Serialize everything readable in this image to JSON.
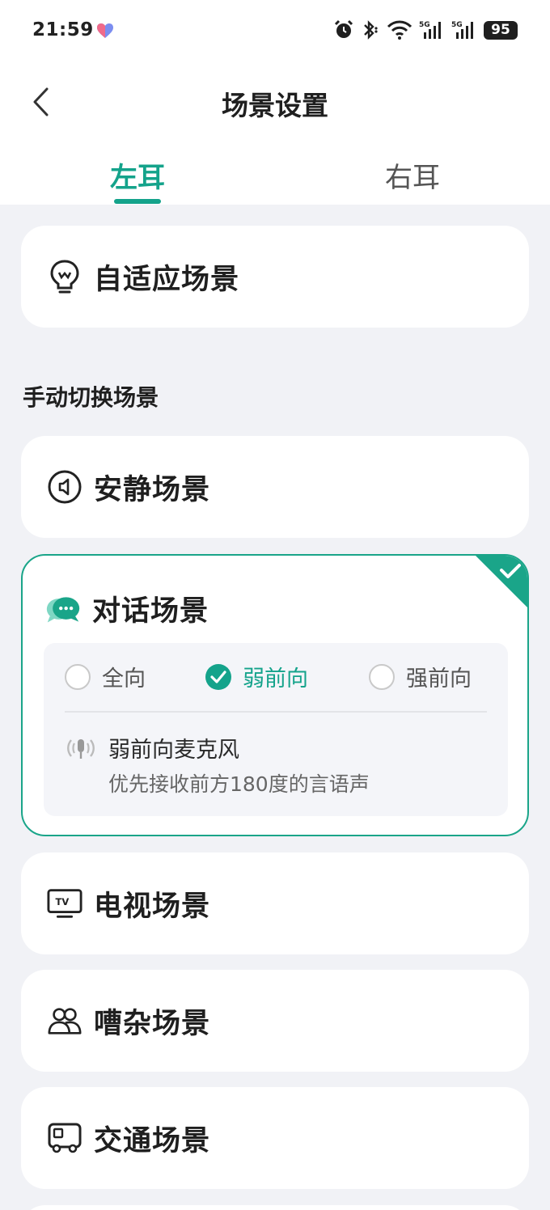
{
  "status_bar": {
    "time": "21:59",
    "battery": "95"
  },
  "header": {
    "title": "场景设置"
  },
  "tabs": [
    {
      "label": "左耳",
      "active": true
    },
    {
      "label": "右耳",
      "active": false
    }
  ],
  "adaptive": {
    "label": "自适应场景",
    "icon": "bulb-icon"
  },
  "manual_section": {
    "title": "手动切换场景"
  },
  "scenes": {
    "quiet": {
      "label": "安静场景",
      "icon": "speaker-icon"
    },
    "conversation": {
      "label": "对话场景",
      "icon": "chat-icon",
      "selected": true,
      "options": [
        {
          "label": "全向",
          "checked": false
        },
        {
          "label": "弱前向",
          "checked": true
        },
        {
          "label": "强前向",
          "checked": false
        }
      ],
      "description_title": "弱前向麦克风",
      "description_text": "优先接收前方180度的言语声"
    },
    "tv": {
      "label": "电视场景",
      "icon": "tv-icon"
    },
    "noisy": {
      "label": "嘈杂场景",
      "icon": "crowd-icon"
    },
    "traffic": {
      "label": "交通场景",
      "icon": "bus-icon"
    }
  },
  "colors": {
    "accent": "#14a38b",
    "background": "#f1f2f6"
  }
}
